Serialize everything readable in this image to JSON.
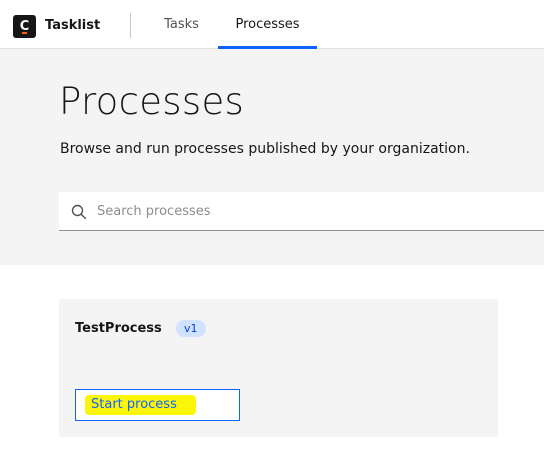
{
  "header": {
    "app_name": "Tasklist",
    "logo_letter": "C",
    "tabs": [
      {
        "label": "Tasks",
        "active": false
      },
      {
        "label": "Processes",
        "active": true
      }
    ]
  },
  "hero": {
    "title": "Processes",
    "subtitle": "Browse and run processes published by your organization.",
    "search": {
      "placeholder": "Search processes",
      "value": ""
    }
  },
  "processes": [
    {
      "name": "TestProcess",
      "version": "v1",
      "action_label": "Start process"
    }
  ],
  "colors": {
    "accent": "#0f62fe",
    "hero_bg": "#f4f4f4",
    "tag_bg": "#d0e2ff",
    "highlight": "#fbf50a",
    "logo_bg": "#161616"
  },
  "icons": {
    "logo": "camunda-c-logo-icon",
    "search": "search-icon"
  }
}
